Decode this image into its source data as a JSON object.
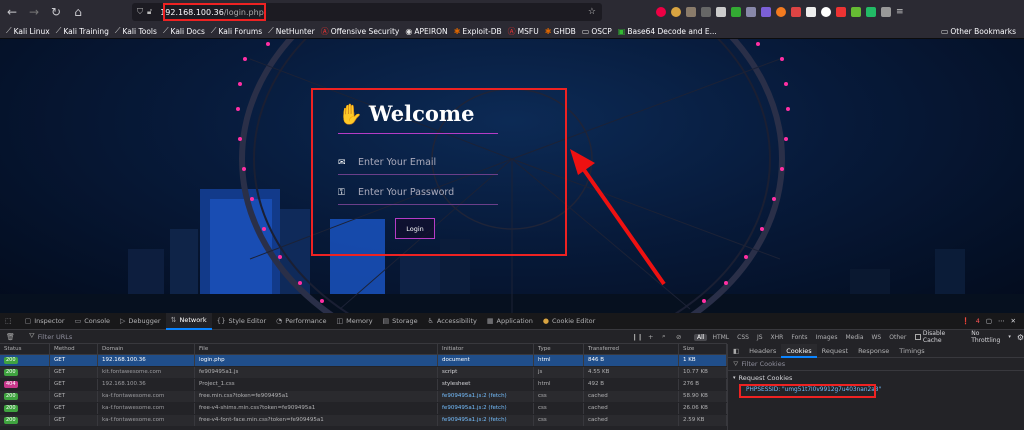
{
  "browser": {
    "url_host": "192.168.100.36",
    "url_path": "/login.php",
    "nav_icons": [
      "back-arrow-icon",
      "forward-arrow-icon",
      "reload-icon",
      "home-icon"
    ]
  },
  "bookmarks": [
    "Kali Linux",
    "Kali Training",
    "Kali Tools",
    "Kali Docs",
    "Kali Forums",
    "NetHunter",
    "Offensive Security",
    "APEIRON",
    "Exploit-DB",
    "MSFU",
    "GHDB",
    "OSCP",
    "Base64 Decode and E...",
    "Other Bookmarks"
  ],
  "login": {
    "title": "Welcome",
    "email_placeholder": "Enter Your Email",
    "password_placeholder": "Enter Your Password",
    "button": "Login"
  },
  "devtools": {
    "tabs": [
      "Inspector",
      "Console",
      "Debugger",
      "Network",
      "Style Editor",
      "Performance",
      "Memory",
      "Storage",
      "Accessibility",
      "Application",
      "Cookie Editor"
    ],
    "active_tab": "Network",
    "error_count": "4",
    "filter_placeholder": "Filter URLs",
    "type_filters": [
      "All",
      "HTML",
      "CSS",
      "JS",
      "XHR",
      "Fonts",
      "Images",
      "Media",
      "WS",
      "Other"
    ],
    "disable_cache": "Disable Cache",
    "throttling": "No Throttling",
    "columns": [
      "Status",
      "Method",
      "Domain",
      "File",
      "Initiator",
      "Type",
      "Transferred",
      "Size"
    ],
    "requests": [
      {
        "status": "200",
        "method": "GET",
        "domain": "192.168.100.36",
        "file": "login.php",
        "initiator": "document",
        "type": "html",
        "transferred": "846 B",
        "size": "1 KB"
      },
      {
        "status": "200",
        "method": "GET",
        "domain": "kit.fontawesome.com",
        "file": "fe909495a1.js",
        "initiator": "script",
        "type": "js",
        "transferred": "4.55 KB",
        "size": "10.77 KB"
      },
      {
        "status": "404",
        "method": "GET",
        "domain": "192.168.100.36",
        "file": "Project_1.css",
        "initiator": "stylesheet",
        "type": "html",
        "transferred": "492 B",
        "size": "276 B"
      },
      {
        "status": "200",
        "method": "GET",
        "domain": "ka-f.fontawesome.com",
        "file": "free.min.css?token=fe909495a1",
        "initiator": "fe909495a1.js:2 (fetch)",
        "type": "css",
        "transferred": "cached",
        "size": "58.90 KB"
      },
      {
        "status": "200",
        "method": "GET",
        "domain": "ka-f.fontawesome.com",
        "file": "free-v4-shims.min.css?token=fe909495a1",
        "initiator": "fe909495a1.js:2 (fetch)",
        "type": "css",
        "transferred": "cached",
        "size": "26.06 KB"
      },
      {
        "status": "200",
        "method": "GET",
        "domain": "ka-f.fontawesome.com",
        "file": "free-v4-font-face.min.css?token=fe909495a1",
        "initiator": "fe909495a1.js:2 (fetch)",
        "type": "css",
        "transferred": "cached",
        "size": "2.59 KB"
      }
    ],
    "side_tabs": [
      "Headers",
      "Cookies",
      "Request",
      "Response",
      "Timings"
    ],
    "active_side_tab": "Cookies",
    "filter_cookies": "Filter Cookies",
    "request_cookies_label": "Request Cookies",
    "cookie": "PHPSESSID: \"umg51t7l0v9912g7u403nan2a8\""
  },
  "colors": {
    "highlight": "#ee2222",
    "accent": "#0a84ff",
    "status_ok": "#3fa33f",
    "status_404": "#c8388c"
  }
}
